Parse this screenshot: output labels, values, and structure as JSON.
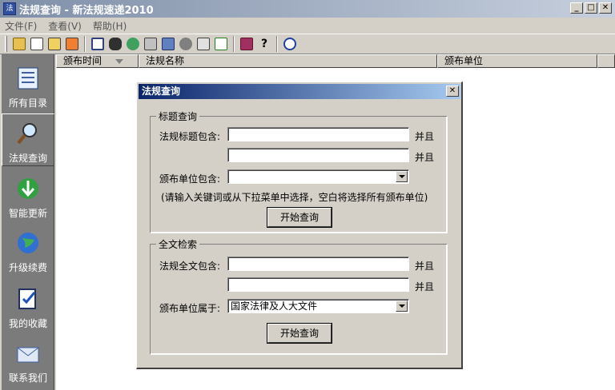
{
  "window": {
    "title": "法规查询 - 新法规速递2010",
    "icon_text": "法"
  },
  "menubar": {
    "items": [
      "文件(F)",
      "查看(V)",
      "帮助(H)"
    ]
  },
  "toolbar": {
    "icons": [
      "open-folder-icon",
      "export-icon",
      "copy-icon",
      "paste-icon",
      "book-icon",
      "binoculars-icon",
      "search-globe-icon",
      "print-icon",
      "network-icon",
      "settings-icon",
      "cursor-icon",
      "refresh-icon",
      "reader-icon",
      "help-icon",
      "power-icon"
    ]
  },
  "sidebar": {
    "items": [
      {
        "label": "所有目录",
        "icon": "directory-icon"
      },
      {
        "label": "法规查询",
        "icon": "magnifier-icon"
      },
      {
        "label": "智能更新",
        "icon": "download-arrow-icon"
      },
      {
        "label": "升级续费",
        "icon": "globe-icon"
      },
      {
        "label": "我的收藏",
        "icon": "favorites-icon"
      },
      {
        "label": "联系我们",
        "icon": "mail-icon"
      }
    ]
  },
  "list": {
    "columns": [
      "颁布时间",
      "法规名称",
      "颁布单位"
    ]
  },
  "dialog": {
    "title": "法规查询",
    "close_label": "✕",
    "title_search": {
      "legend": "标题查询",
      "title_contains_label": "法规标题包含:",
      "title_input_1": "",
      "title_input_2": "",
      "and_label": "并且",
      "issuer_contains_label": "颁布单位包含:",
      "issuer_value": "",
      "hint": "(请输入关键词或从下拉菜单中选择，空白将选择所有颁布单位)",
      "search_button": "开始查询"
    },
    "fulltext_search": {
      "legend": "全文检索",
      "fulltext_contains_label": "法规全文包含:",
      "fulltext_input_1": "",
      "fulltext_input_2": "",
      "and_label": "并且",
      "issuer_belongs_label": "颁布单位属于:",
      "issuer_value": "国家法律及人大文件",
      "search_button": "开始查询"
    }
  }
}
